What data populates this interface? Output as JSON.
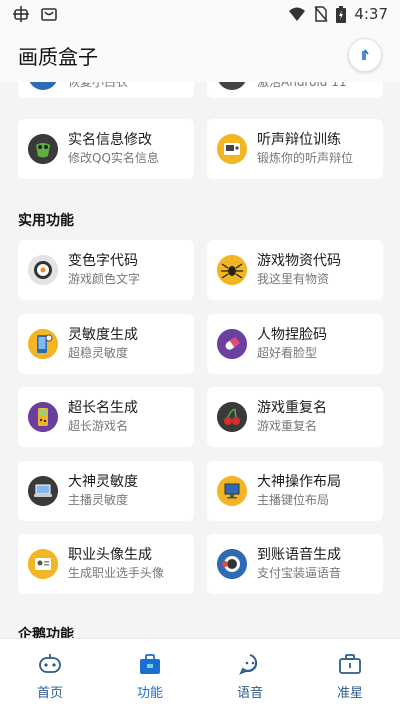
{
  "status": {
    "time": "4:37",
    "colors": {
      "text": "#333333"
    }
  },
  "app": {
    "title": "画质盒子"
  },
  "partial_top": [
    {
      "sub": "恢复小白衣"
    },
    {
      "sub": "激活Android 11"
    }
  ],
  "top_cards": [
    {
      "title": "实名信息修改",
      "sub": "修改QQ实名信息",
      "icon": "frog-icon"
    },
    {
      "title": "听声辩位训练",
      "sub": "锻炼你的听声辩位",
      "icon": "radio-icon"
    }
  ],
  "sections": [
    {
      "title": "实用功能",
      "cards": [
        {
          "title": "变色字代码",
          "sub": "游戏颜色文字",
          "icon": "sushi-icon"
        },
        {
          "title": "游戏物资代码",
          "sub": "我这里有物资",
          "icon": "spider-icon"
        },
        {
          "title": "灵敏度生成",
          "sub": "超稳灵敏度",
          "icon": "phone-settings-icon"
        },
        {
          "title": "人物捏脸码",
          "sub": "超好看脸型",
          "icon": "pill-icon"
        },
        {
          "title": "超长名生成",
          "sub": "超长游戏名",
          "icon": "gameboy-icon"
        },
        {
          "title": "游戏重复名",
          "sub": "游戏重复名",
          "icon": "cherry-icon"
        },
        {
          "title": "大神灵敏度",
          "sub": "主播灵敏度",
          "icon": "laptop-icon"
        },
        {
          "title": "大神操作布局",
          "sub": "主播键位布局",
          "icon": "computer-icon"
        },
        {
          "title": "职业头像生成",
          "sub": "生成职业选手头像",
          "icon": "avatar-icon"
        },
        {
          "title": "到账语音生成",
          "sub": "支付宝装逼语音",
          "icon": "coin-icon"
        }
      ]
    },
    {
      "title": "企鹅功能"
    }
  ],
  "tabs": [
    {
      "label": "首页",
      "icon": "robot-icon"
    },
    {
      "label": "功能",
      "icon": "toolbox-icon",
      "active": true
    },
    {
      "label": "语音",
      "icon": "speech-face-icon"
    },
    {
      "label": "准星",
      "icon": "briefcase-icon"
    }
  ],
  "colors": {
    "accent": "#1b6ecf",
    "tab_inactive": "#2d5b8c",
    "background": "#f4f4f4",
    "card": "#ffffff"
  }
}
